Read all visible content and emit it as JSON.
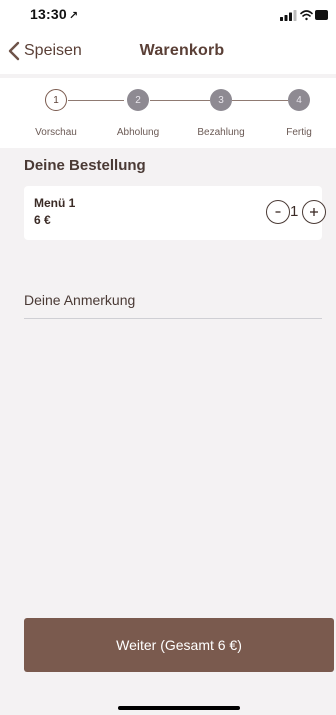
{
  "status_bar": {
    "time": "13:30",
    "location_glyph": "↗"
  },
  "nav": {
    "back_label": "Speisen",
    "title": "Warenkorb"
  },
  "steps": [
    {
      "number": "1",
      "label": "Vorschau",
      "state": "active"
    },
    {
      "number": "2",
      "label": "Abholung",
      "state": "inactive"
    },
    {
      "number": "3",
      "label": "Bezahlung",
      "state": "inactive"
    },
    {
      "number": "4",
      "label": "Fertig",
      "state": "inactive"
    }
  ],
  "order": {
    "section_title": "Deine Bestellung",
    "items": [
      {
        "name": "Menü 1",
        "price": "6 €",
        "quantity": "1",
        "minus": "-",
        "plus": "+"
      }
    ]
  },
  "note": {
    "label": "Deine Anmerkung"
  },
  "cta": {
    "label": "Weiter  (Gesamt 6 €)"
  },
  "colors": {
    "brand": "#7a5a4e",
    "background": "#f4f2f3",
    "step_inactive": "#8e8a92"
  }
}
